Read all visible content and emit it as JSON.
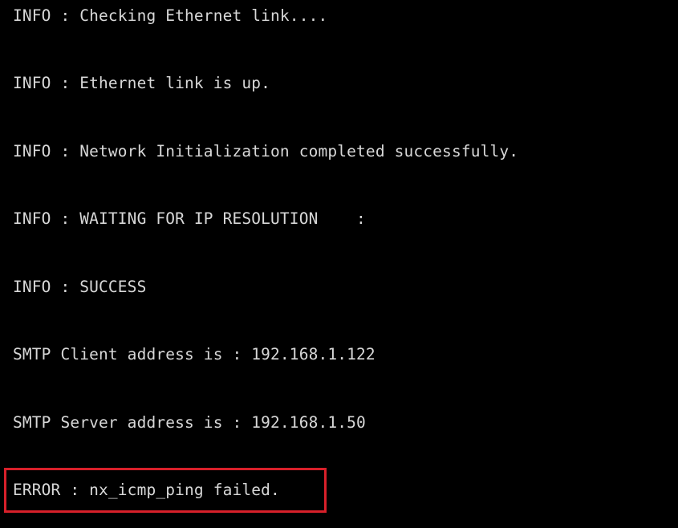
{
  "terminal": {
    "lines": [
      "INFO : Checking Ethernet link....",
      "INFO : Ethernet link is up.",
      "INFO : Network Initialization completed successfully.",
      "INFO : WAITING FOR IP RESOLUTION    :",
      "INFO : SUCCESS",
      "SMTP Client address is : 192.168.1.122",
      "SMTP Server address is : 192.168.1.50",
      "ERROR : nx_icmp_ping failed."
    ],
    "colors": {
      "background": "#000000",
      "text": "#d8d8d8",
      "highlight_border": "#d8202a"
    }
  }
}
